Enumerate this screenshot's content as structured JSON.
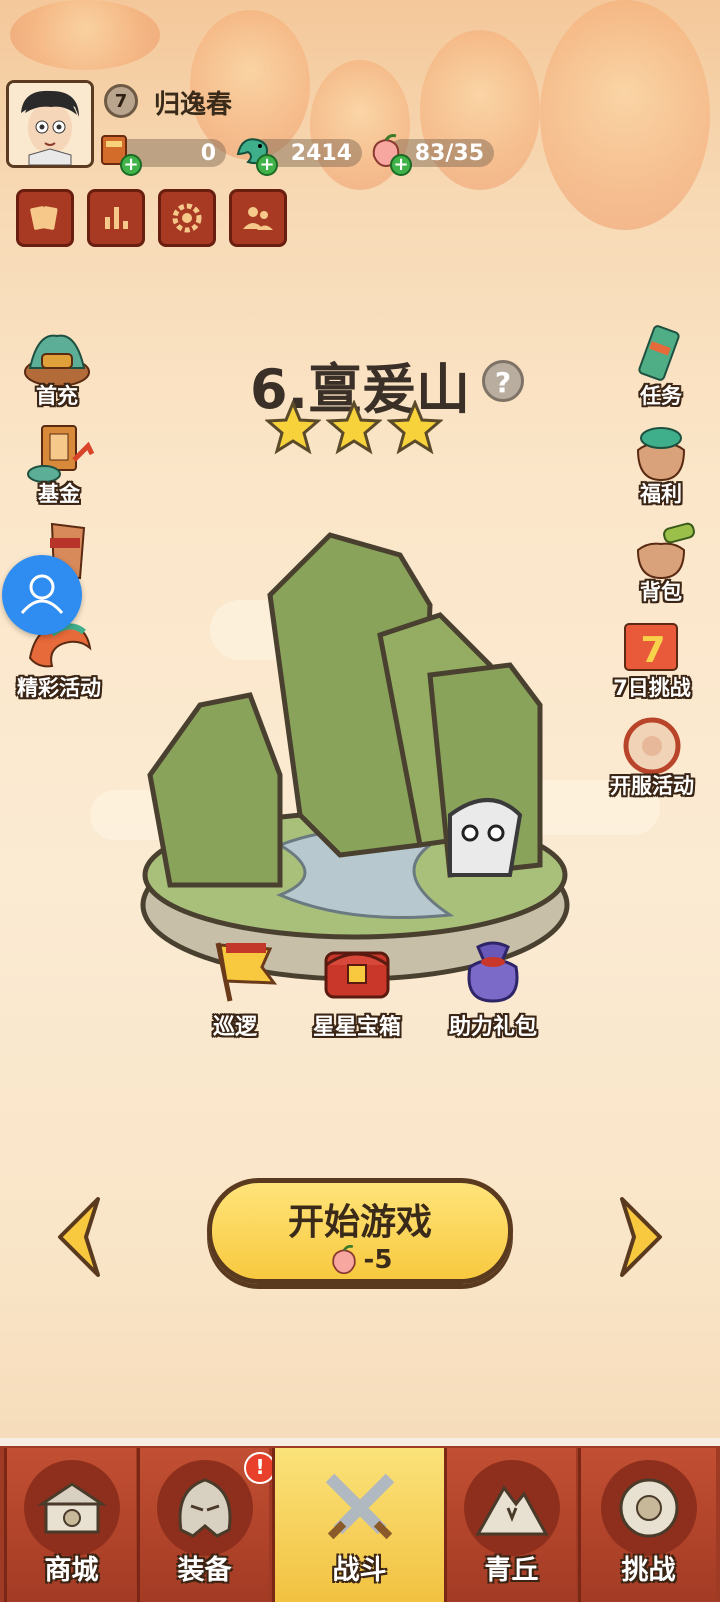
{
  "player": {
    "level": "7",
    "name": "归逸春"
  },
  "resources": [
    {
      "name": "tickets",
      "value": "0",
      "icon": "ticket-scroll-icon"
    },
    {
      "name": "jade",
      "value": "2414",
      "icon": "jade-dragon-icon"
    },
    {
      "name": "stamina",
      "value": "83/35",
      "icon": "peach-icon"
    }
  ],
  "top_buttons": [
    "card-icon",
    "bar-chart-icon",
    "gear-icon",
    "friends-icon"
  ],
  "left_menu": [
    {
      "label": "首充",
      "icon": "first-recharge-icon"
    },
    {
      "label": "基金",
      "icon": "fund-icon"
    },
    {
      "label": "",
      "icon": "scroll-gift-icon"
    },
    {
      "label": "精彩活动",
      "icon": "events-icon"
    }
  ],
  "right_menu": [
    {
      "label": "任务",
      "icon": "quest-scroll-icon"
    },
    {
      "label": "福利",
      "icon": "welfare-bag-icon"
    },
    {
      "label": "背包",
      "icon": "backpack-icon"
    },
    {
      "label": "7日挑战",
      "icon": "seven-day-icon"
    },
    {
      "label": "开服活动",
      "icon": "server-event-icon"
    }
  ],
  "stage": {
    "title": "6.亶爰山",
    "stars": 3,
    "help": "?"
  },
  "stage_buttons": [
    {
      "label": "巡逻",
      "icon": "patrol-flag-icon"
    },
    {
      "label": "星星宝箱",
      "icon": "star-chest-icon"
    },
    {
      "label": "助力礼包",
      "icon": "gift-bag-icon"
    }
  ],
  "start": {
    "label": "开始游戏",
    "cost": "-5"
  },
  "bottom_nav": [
    {
      "label": "商城",
      "active": false,
      "badge": false
    },
    {
      "label": "装备",
      "active": false,
      "badge": true
    },
    {
      "label": "战斗",
      "active": true,
      "badge": false
    },
    {
      "label": "青丘",
      "active": false,
      "badge": false
    },
    {
      "label": "挑战",
      "active": false,
      "badge": false
    }
  ],
  "colors": {
    "accent": "#f8c93f",
    "nav": "#a33b24",
    "bg": "#fbe6c9"
  }
}
